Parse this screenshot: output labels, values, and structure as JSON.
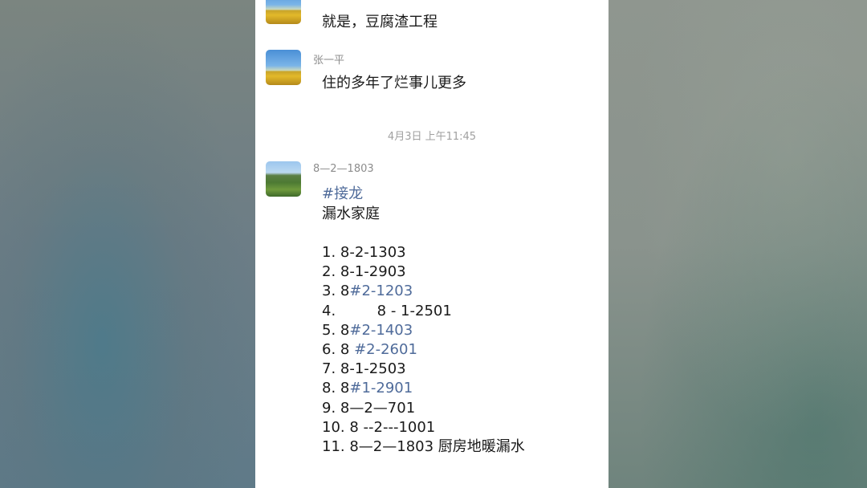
{
  "chat": {
    "msg1": {
      "text": "就是，豆腐渣工程"
    },
    "msg2": {
      "sender": "张一平",
      "text": "住的多年了烂事儿更多"
    },
    "timestamp": "4月3日 上午11:45",
    "msg3": {
      "sender": "8—2—1803",
      "tag": "#接龙",
      "title": "漏水家庭",
      "items": [
        {
          "plain": "1. 8-2-1303",
          "link": ""
        },
        {
          "plain": "2. 8-1-2903",
          "link": ""
        },
        {
          "plain": "3. 8",
          "link": "#2-1203"
        },
        {
          "plain": "4.         8 - 1-2501",
          "link": ""
        },
        {
          "plain": "5. 8",
          "link": "#2-1403"
        },
        {
          "plain": "6. 8 ",
          "link": "#2-2601"
        },
        {
          "plain": "7. 8-1-2503",
          "link": ""
        },
        {
          "plain": "8. 8",
          "link": "#1-2901"
        },
        {
          "plain": "9. 8—2—701",
          "link": ""
        },
        {
          "plain": "10. 8 --2---1001",
          "link": ""
        },
        {
          "plain": "11. 8—2—1803 厨房地暖漏水",
          "link": ""
        }
      ]
    }
  }
}
